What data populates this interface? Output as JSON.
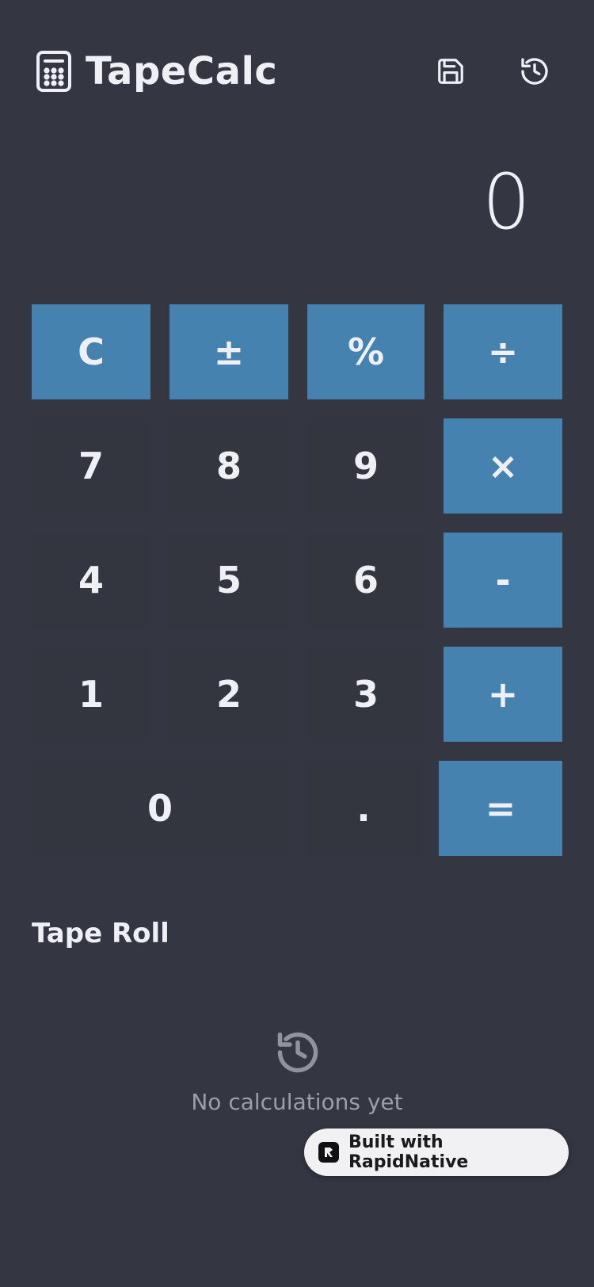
{
  "app": {
    "title": "TapeCalc",
    "icon": "calculator-icon"
  },
  "header": {
    "actions": [
      {
        "name": "save-icon"
      },
      {
        "name": "history-icon"
      }
    ]
  },
  "display": {
    "value": "0"
  },
  "keypad": {
    "rows": [
      [
        {
          "label": "C",
          "kind": "op"
        },
        {
          "label": "±",
          "kind": "op"
        },
        {
          "label": "%",
          "kind": "op"
        },
        {
          "label": "÷",
          "kind": "op"
        }
      ],
      [
        {
          "label": "7",
          "kind": "num"
        },
        {
          "label": "8",
          "kind": "num"
        },
        {
          "label": "9",
          "kind": "num"
        },
        {
          "label": "×",
          "kind": "op"
        }
      ],
      [
        {
          "label": "4",
          "kind": "num"
        },
        {
          "label": "5",
          "kind": "num"
        },
        {
          "label": "6",
          "kind": "num"
        },
        {
          "label": "-",
          "kind": "op"
        }
      ],
      [
        {
          "label": "1",
          "kind": "num"
        },
        {
          "label": "2",
          "kind": "num"
        },
        {
          "label": "3",
          "kind": "num"
        },
        {
          "label": "+",
          "kind": "op"
        }
      ],
      [
        {
          "label": "0",
          "kind": "num"
        },
        {
          "label": ".",
          "kind": "num"
        },
        {
          "label": "=",
          "kind": "op"
        }
      ]
    ]
  },
  "tape": {
    "title": "Tape Roll",
    "empty_icon": "history-icon",
    "empty_text": "No calculations yet"
  },
  "badge": {
    "text": "Built with RapidNative",
    "icon": "rapidnative-logo-icon"
  },
  "colors": {
    "background": "#343742",
    "accent": "#4682b0",
    "text": "#eef0f6",
    "muted": "#9a9fab"
  }
}
